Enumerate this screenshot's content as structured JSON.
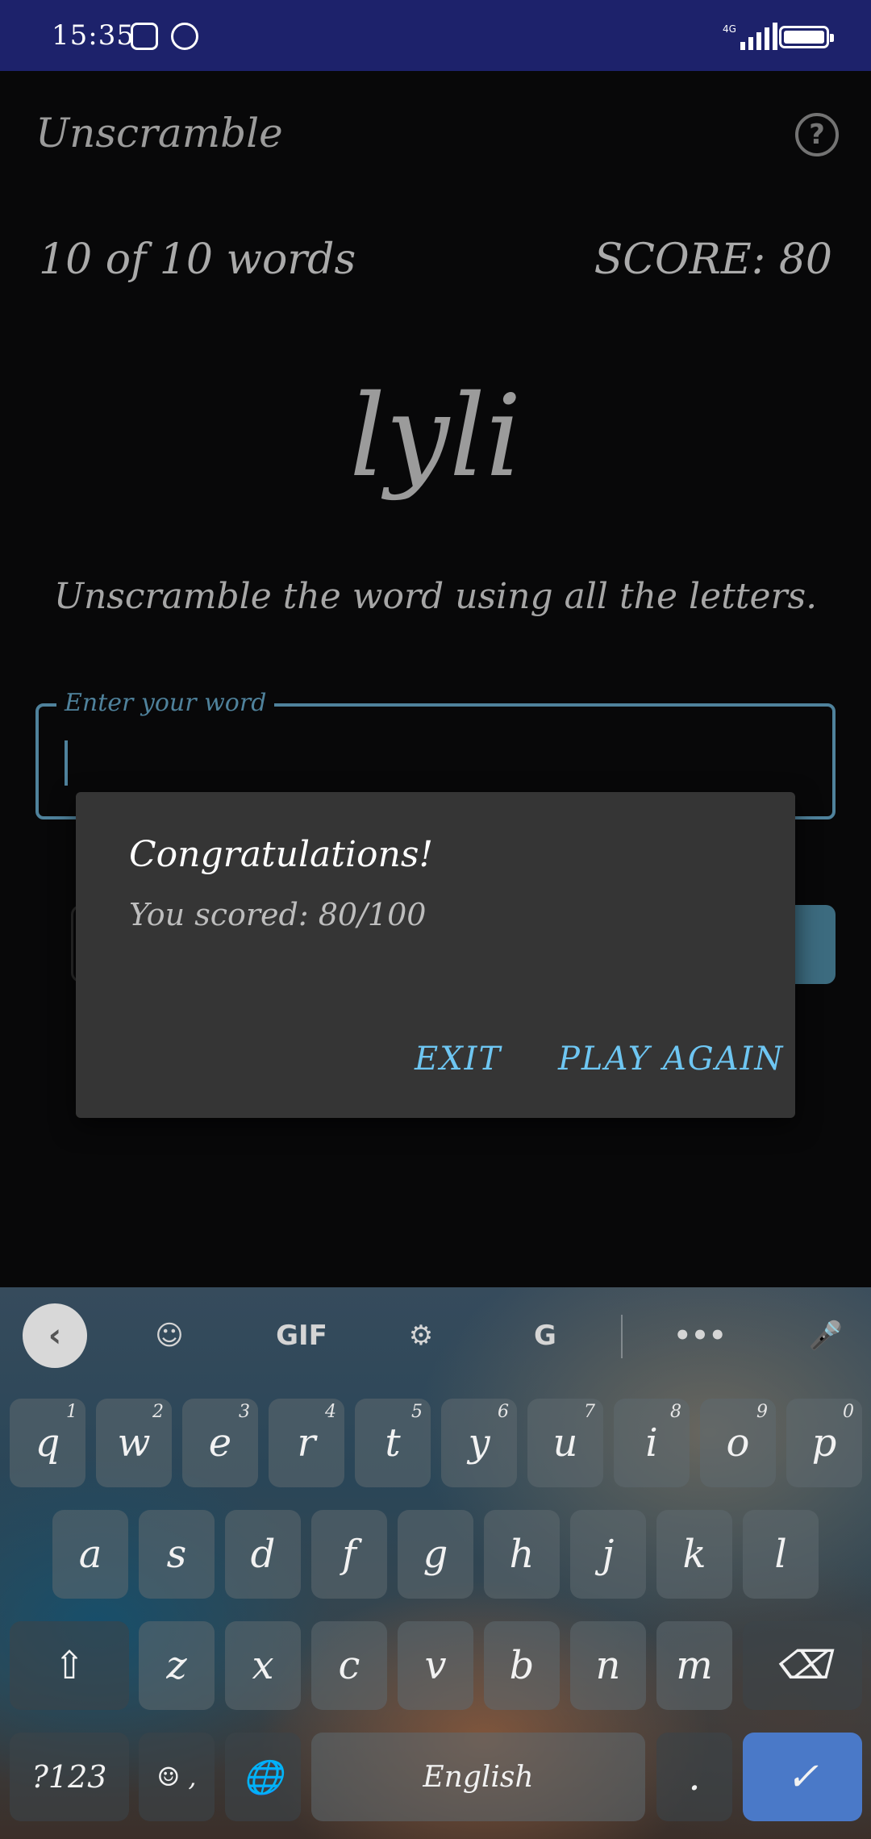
{
  "status_bar": {
    "time": "15:35",
    "network": "4G",
    "icons": [
      "saavn-icon",
      "whatsapp-icon",
      "signal-icon",
      "battery-icon"
    ]
  },
  "app": {
    "title": "Unscramble",
    "help_icon": "?",
    "word_count": "10 of 10 words",
    "score": "SCORE: 80",
    "scrambled_word": "lyli",
    "instructions": "Unscramble the word using all the letters.",
    "input": {
      "label": "Enter your word",
      "value": ""
    }
  },
  "dialog": {
    "title": "Congratulations!",
    "message": "You scored: 80/100",
    "exit_label": "EXIT",
    "play_again_label": "PLAY AGAIN"
  },
  "keyboard": {
    "toolbar": {
      "back": "‹",
      "sticker": "☺",
      "gif": "GIF",
      "settings": "⚙",
      "translate": "G",
      "more": "•••",
      "mic": "🎤"
    },
    "row1": [
      {
        "k": "q",
        "n": "1"
      },
      {
        "k": "w",
        "n": "2"
      },
      {
        "k": "e",
        "n": "3"
      },
      {
        "k": "r",
        "n": "4"
      },
      {
        "k": "t",
        "n": "5"
      },
      {
        "k": "y",
        "n": "6"
      },
      {
        "k": "u",
        "n": "7"
      },
      {
        "k": "i",
        "n": "8"
      },
      {
        "k": "o",
        "n": "9"
      },
      {
        "k": "p",
        "n": "0"
      }
    ],
    "row2": [
      "a",
      "s",
      "d",
      "f",
      "g",
      "h",
      "j",
      "k",
      "l"
    ],
    "row3": [
      "z",
      "x",
      "c",
      "v",
      "b",
      "n",
      "m"
    ],
    "shift": "⇧",
    "backspace": "⌫",
    "symbols": "?123",
    "emoji": "☺ ,",
    "globe": "🌐",
    "space": "English",
    "period": ".",
    "enter": "✓"
  },
  "colors": {
    "accent": "#6ec6f2",
    "status_bar": "#1d226b",
    "dialog_bg": "#353535"
  }
}
